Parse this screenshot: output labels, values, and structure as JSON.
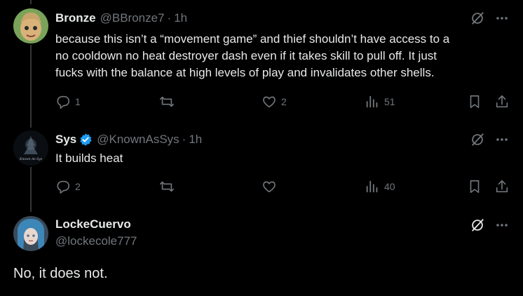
{
  "colors": {
    "background": "#000000",
    "text": "#e7e9ea",
    "muted": "#71767b",
    "verified": "#1d9bf0",
    "thread_line": "#333639"
  },
  "tweets": [
    {
      "name": "Bronze",
      "handle": "@BBronze7",
      "dot": "·",
      "time": "1h",
      "lines": [
        "because this isn’t a “movement game” and thief shouldn’t have access to a",
        "no cooldown no heat destroyer dash even if it takes skill to pull off. It just",
        "fucks with the balance at high levels of play and invalidates other shells."
      ],
      "replies": "1",
      "reposts": "",
      "likes": "2",
      "views": "51"
    },
    {
      "name": "Sys",
      "handle": "@KnownAsSys",
      "dot": "·",
      "time": "1h",
      "avatar_caption": "Known As Sys",
      "lines": [
        "It builds heat"
      ],
      "replies": "2",
      "reposts": "",
      "likes": "",
      "views": "40"
    }
  ],
  "main_tweet": {
    "name": "LockeCuervo",
    "handle": "@lockecole777",
    "text": "No, it does not."
  },
  "icons": [
    "grok-icon",
    "more-icon",
    "reply-icon",
    "repost-icon",
    "like-icon",
    "views-icon",
    "bookmark-icon",
    "share-icon",
    "verified-icon"
  ]
}
